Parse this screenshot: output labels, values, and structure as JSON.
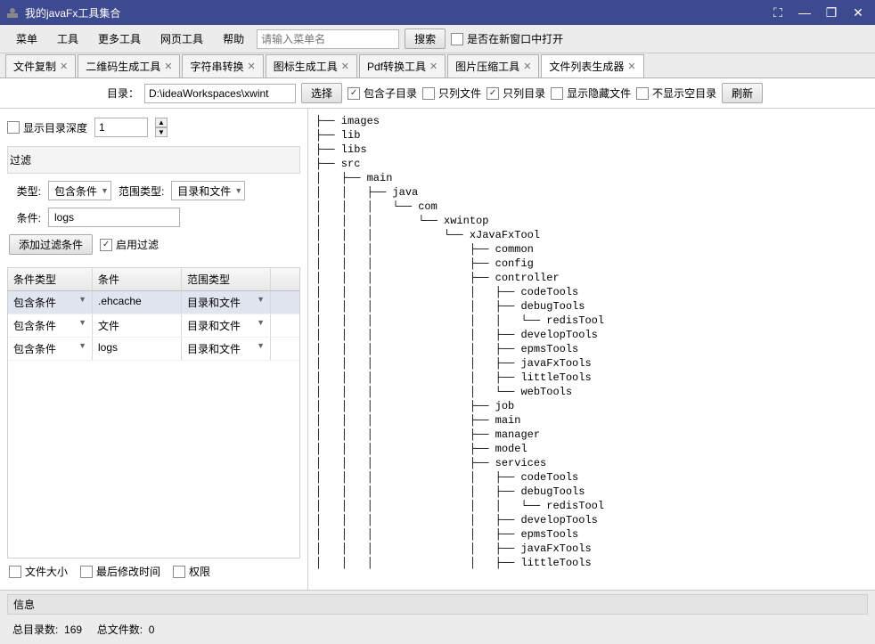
{
  "window": {
    "title": "我的javaFx工具集合",
    "maximize_icon": "⛶",
    "minimize_icon": "—",
    "restore_icon": "❐",
    "close_icon": "✕"
  },
  "menubar": {
    "items": [
      "菜单",
      "工具",
      "更多工具",
      "网页工具",
      "帮助"
    ],
    "search_placeholder": "请输入菜单名",
    "search_btn": "搜索",
    "new_window_label": "是否在新窗口中打开"
  },
  "tabs": [
    {
      "label": "文件复制",
      "active": false
    },
    {
      "label": "二维码生成工具",
      "active": false
    },
    {
      "label": "字符串转换",
      "active": false
    },
    {
      "label": "图标生成工具",
      "active": false
    },
    {
      "label": "Pdf转换工具",
      "active": false
    },
    {
      "label": "图片压缩工具",
      "active": false
    },
    {
      "label": "文件列表生成器",
      "active": true
    }
  ],
  "toolbar": {
    "dir_label": "目录：",
    "path_value": "D:\\ideaWorkspaces\\xwint",
    "choose_btn": "选择",
    "include_sub": "包含子目录",
    "only_files": "只列文件",
    "only_dirs": "只列目录",
    "show_hidden": "显示隐藏文件",
    "hide_empty": "不显示空目录",
    "refresh_btn": "刷新",
    "include_sub_checked": true,
    "only_files_checked": false,
    "only_dirs_checked": true,
    "show_hidden_checked": false,
    "hide_empty_checked": false
  },
  "left": {
    "show_depth_label": "显示目录深度",
    "depth_value": "1",
    "filter_title": "过滤",
    "type_label": "类型:",
    "type_value": "包含条件",
    "scope_type_label": "范围类型:",
    "scope_type_value": "目录和文件",
    "cond_label": "条件:",
    "cond_value": "logs",
    "add_filter_btn": "添加过滤条件",
    "enable_filter_label": "启用过滤",
    "enable_filter_checked": true,
    "table": {
      "headers": [
        "条件类型",
        "条件",
        "范围类型"
      ],
      "rows": [
        {
          "type": "包含条件",
          "cond": ".ehcache",
          "scope": "目录和文件",
          "selected": true
        },
        {
          "type": "包含条件",
          "cond": "文件",
          "scope": "目录和文件",
          "selected": false
        },
        {
          "type": "包含条件",
          "cond": "logs",
          "scope": "目录和文件",
          "selected": false
        }
      ]
    },
    "file_size_label": "文件大小",
    "mod_time_label": "最后修改时间",
    "perm_label": "权限"
  },
  "tree_text": "├── images\n├── lib\n├── libs\n├── src\n│   ├── main\n│   │   ├── java\n│   │   │   └── com\n│   │   │       └── xwintop\n│   │   │           └── xJavaFxTool\n│   │   │               ├── common\n│   │   │               ├── config\n│   │   │               ├── controller\n│   │   │               │   ├── codeTools\n│   │   │               │   ├── debugTools\n│   │   │               │   │   └── redisTool\n│   │   │               │   ├── developTools\n│   │   │               │   ├── epmsTools\n│   │   │               │   ├── javaFxTools\n│   │   │               │   ├── littleTools\n│   │   │               │   └── webTools\n│   │   │               ├── job\n│   │   │               ├── main\n│   │   │               ├── manager\n│   │   │               ├── model\n│   │   │               ├── services\n│   │   │               │   ├── codeTools\n│   │   │               │   ├── debugTools\n│   │   │               │   │   └── redisTool\n│   │   │               │   ├── developTools\n│   │   │               │   ├── epmsTools\n│   │   │               │   ├── javaFxTools\n│   │   │               │   ├── littleTools",
  "info": {
    "title": "信息",
    "dir_count_label": "总目录数:",
    "dir_count": "169",
    "file_count_label": "总文件数:",
    "file_count": "0"
  }
}
